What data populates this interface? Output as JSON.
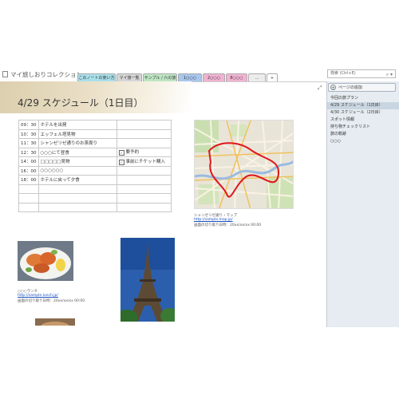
{
  "notebook": {
    "title": "マイ旅しおりコレクション",
    "dropdown_icon": "caret-down-icon",
    "book_icon": "notebook-icon"
  },
  "tabs": [
    {
      "label": "このノートの使い方",
      "color": "#a9dfe9"
    },
    {
      "label": "マイ旅一覧",
      "color": "#d6d6d6"
    },
    {
      "label": "サンプル / 六の旅",
      "color": "#bfe6c4"
    },
    {
      "label": "1○○○",
      "color": "#a9c7ee"
    },
    {
      "label": "2○○○",
      "color": "#f2b3d3"
    },
    {
      "label": "8○○○",
      "color": "#f2b3d3"
    },
    {
      "label": "...",
      "color": "#ececec"
    },
    {
      "label": "+",
      "color": "#ffffff"
    }
  ],
  "search": {
    "placeholder": "検索 (Ctrl+E)"
  },
  "page": {
    "title": "4/29 スケジュール（1日目）",
    "schedule": [
      {
        "time": "09：30",
        "activity": "ホテルを出発",
        "note": "",
        "checked": null
      },
      {
        "time": "10：30",
        "activity": "エッフェル塔見物",
        "note": "",
        "checked": null
      },
      {
        "time": "11：30",
        "activity": "シャンゼリゼ通りのお茶周り",
        "note": "",
        "checked": null
      },
      {
        "time": "12：30",
        "activity": "○○○にて昼食",
        "note": "要予約",
        "checked": true
      },
      {
        "time": "14：00",
        "activity": "□□□□□見物",
        "note": "事前にチケット購入",
        "checked": true
      },
      {
        "time": "16：00",
        "activity": "○○○○○○",
        "note": "",
        "checked": null
      },
      {
        "time": "18：00",
        "activity": "ホテルに戻って夕食",
        "note": "",
        "checked": null
      },
      {
        "time": "",
        "activity": "",
        "note": "",
        "checked": null
      },
      {
        "time": "",
        "activity": "",
        "note": "",
        "checked": null
      },
      {
        "time": "",
        "activity": "",
        "note": "",
        "checked": null
      }
    ],
    "map": {
      "caption": "シャンゼリゼ通り・マップ",
      "link": "http://sample.map.jp/",
      "clip": "画面の切り取り日時：20xx/xx/xx 00:00"
    },
    "food": {
      "caption": "○○○ランチ",
      "link": "http://sample.lunch.jp/",
      "clip": "画面の切り取り日時：20xx/xx/xx 00:00"
    }
  },
  "panel": {
    "add_page": "ページの追加",
    "pages": [
      {
        "label": "今回の旅プラン",
        "selected": false
      },
      {
        "label": "4/29 スケジュール（1日目）",
        "selected": true
      },
      {
        "label": "4/30 スケジュール（2日目）",
        "selected": false
      },
      {
        "label": "スポット情報",
        "selected": false
      },
      {
        "label": "持ち物チェックリスト",
        "selected": false
      },
      {
        "label": "旅の軌跡",
        "selected": false
      },
      {
        "label": "○○○",
        "selected": false
      }
    ]
  }
}
